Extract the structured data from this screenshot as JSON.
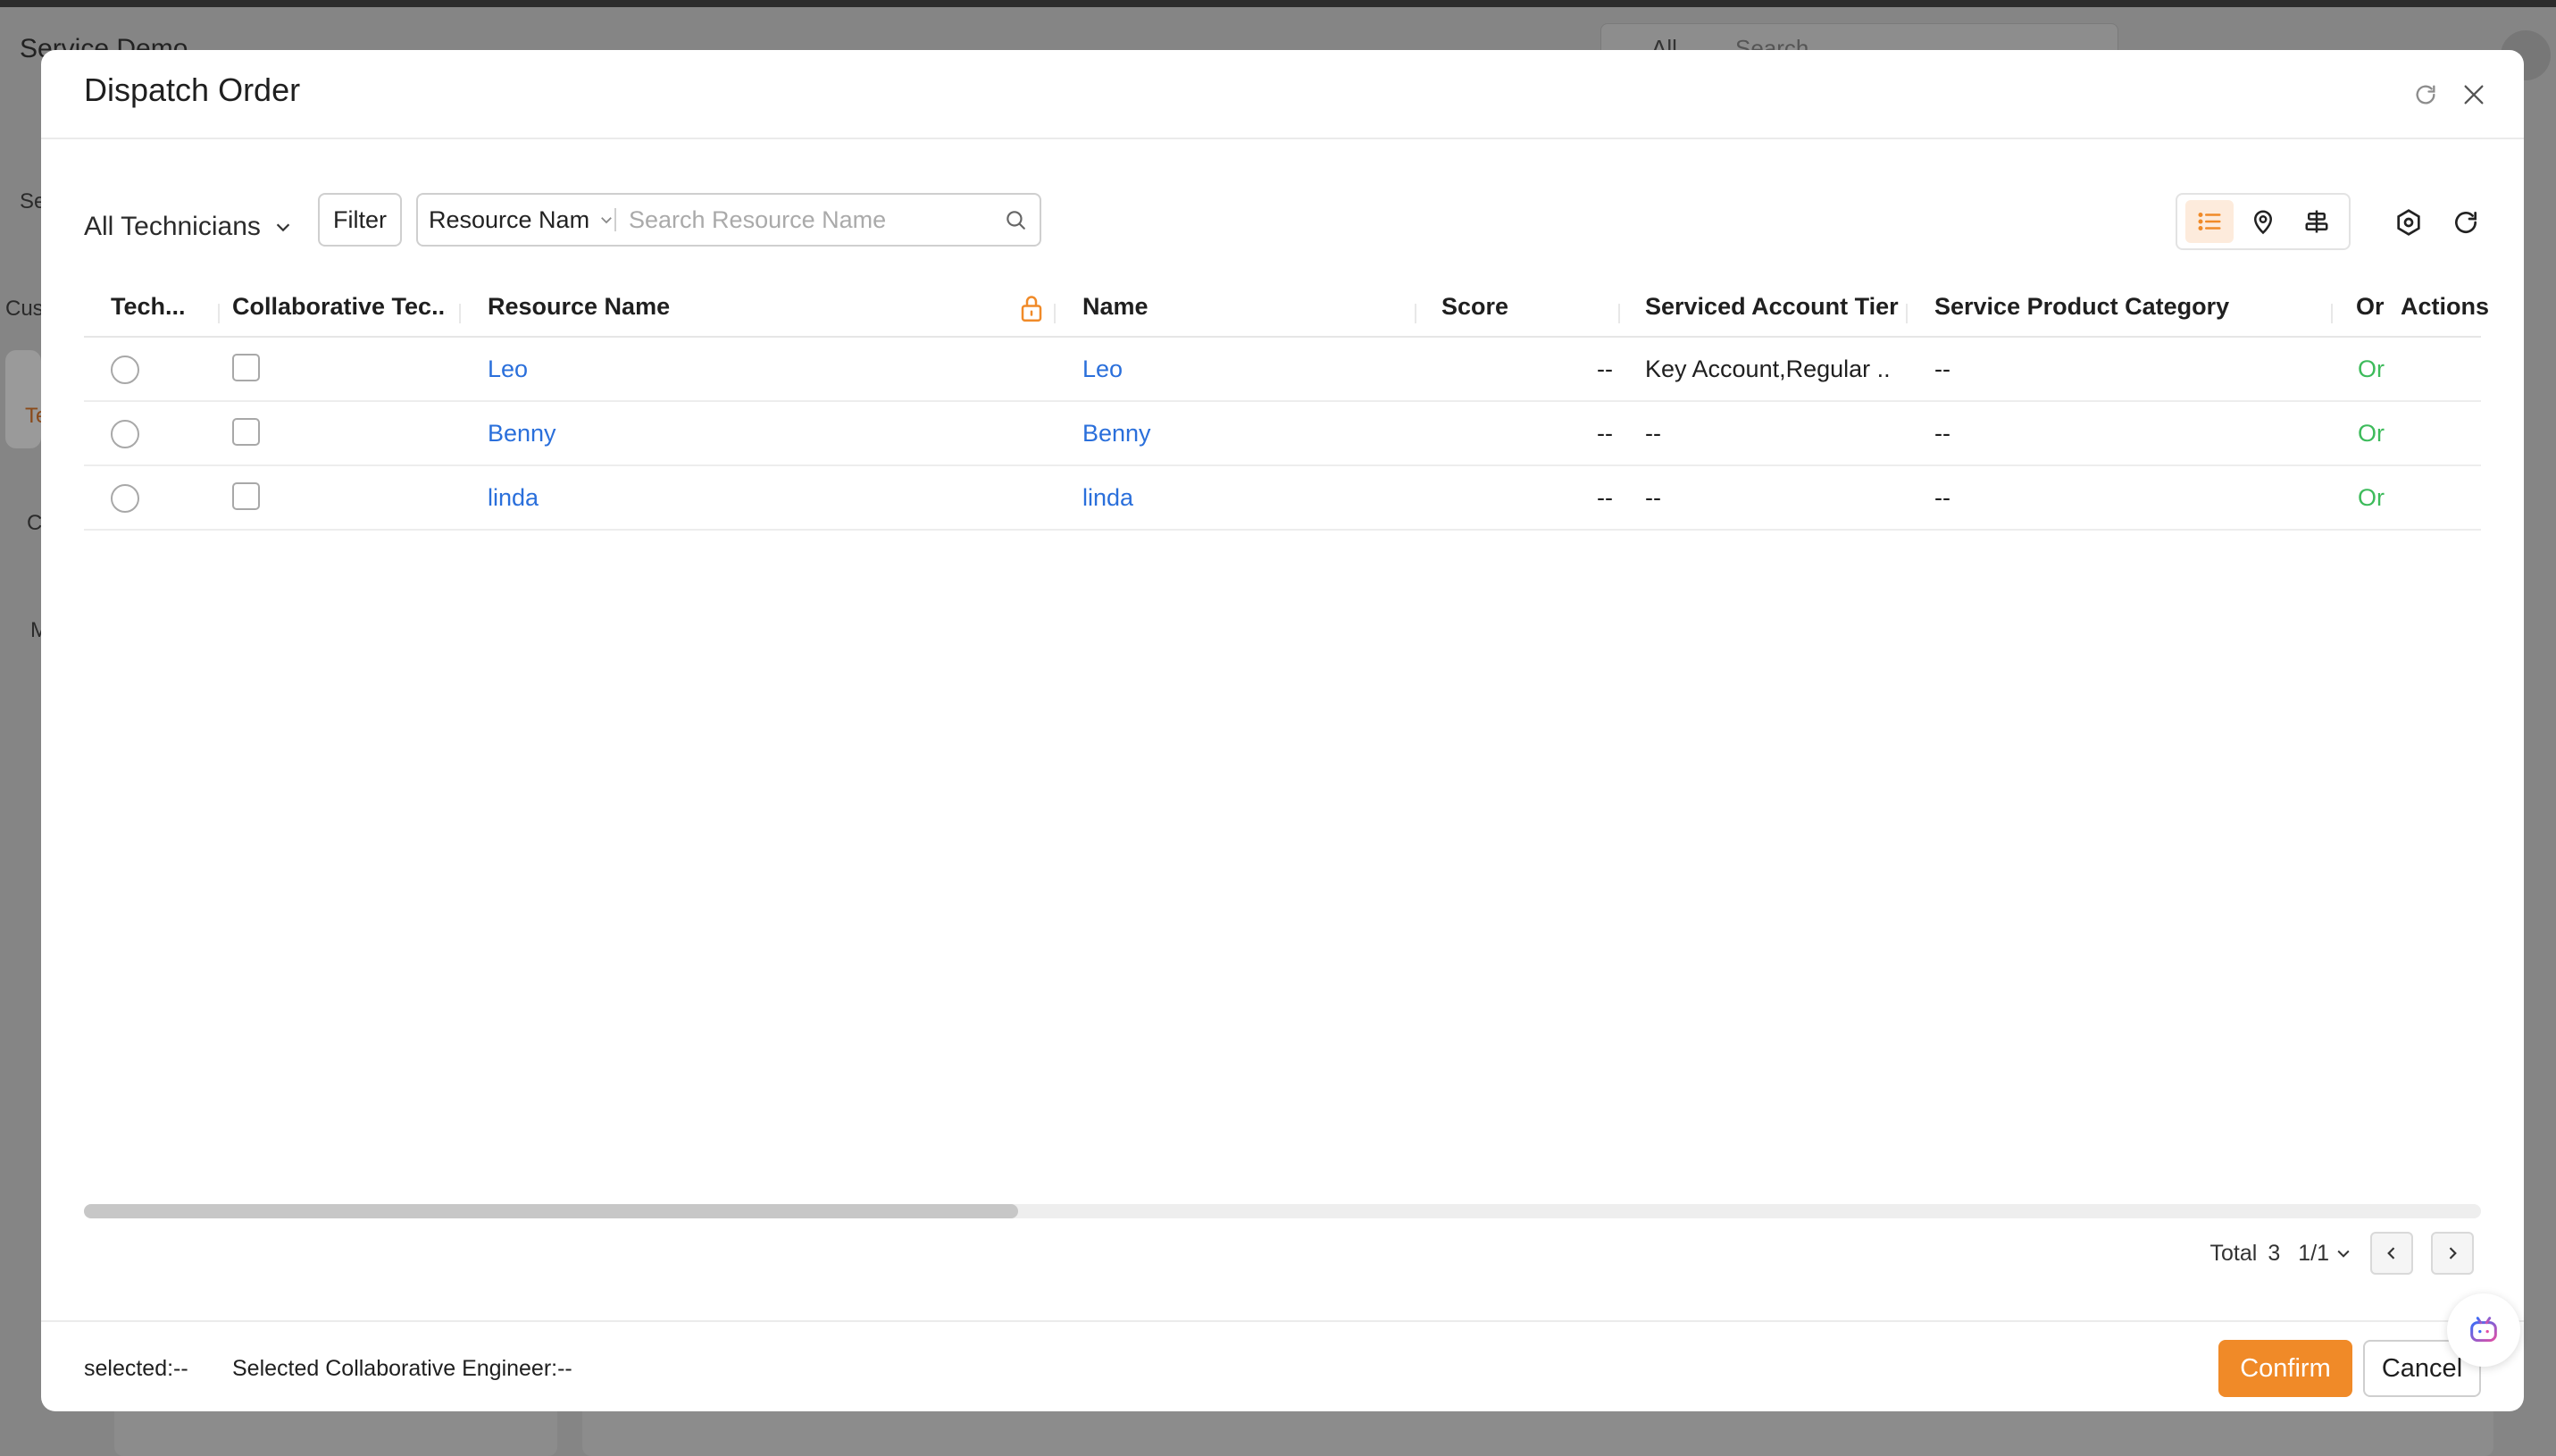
{
  "background": {
    "app_title": "Service Demo",
    "search_scope": "All",
    "search_placeholder": "Search",
    "side_texts": [
      "Se",
      "Cus",
      "Te",
      "C",
      "M"
    ]
  },
  "modal": {
    "title": "Dispatch Order",
    "header_icons": [
      "refresh-icon",
      "close-icon"
    ]
  },
  "toolbar": {
    "technician_scope": "All Technicians",
    "filter_label": "Filter",
    "search_field": "Resource Nam",
    "search_placeholder": "Search Resource Name",
    "views": [
      "list-view-icon",
      "map-view-icon",
      "gantt-view-icon"
    ],
    "active_view": "list",
    "accent_color": "#f08a28"
  },
  "table": {
    "columns": {
      "technician": "Tech...",
      "collaborative": "Collaborative Tec...",
      "resource_name": "Resource Name",
      "name": "Name",
      "score": "Score",
      "tier": "Serviced Account Tier",
      "category": "Service Product Category",
      "or": "Or",
      "actions": "Actions"
    },
    "rows": [
      {
        "resource_name": "Leo",
        "name": "Leo",
        "score": "--",
        "tier": "Key Account,Regular ...",
        "category": "--",
        "or": "Or"
      },
      {
        "resource_name": "Benny",
        "name": "Benny",
        "score": "--",
        "tier": "--",
        "category": "--",
        "or": "Or"
      },
      {
        "resource_name": "linda",
        "name": "linda",
        "score": "--",
        "tier": "--",
        "category": "--",
        "or": "Or"
      }
    ]
  },
  "pagination": {
    "total_label": "Total",
    "total_value": "3",
    "page": "1/1"
  },
  "footer": {
    "selected": "selected:--",
    "collab": "Selected Collaborative Engineer:--",
    "confirm_label": "Confirm",
    "cancel_label": "Cancel"
  }
}
